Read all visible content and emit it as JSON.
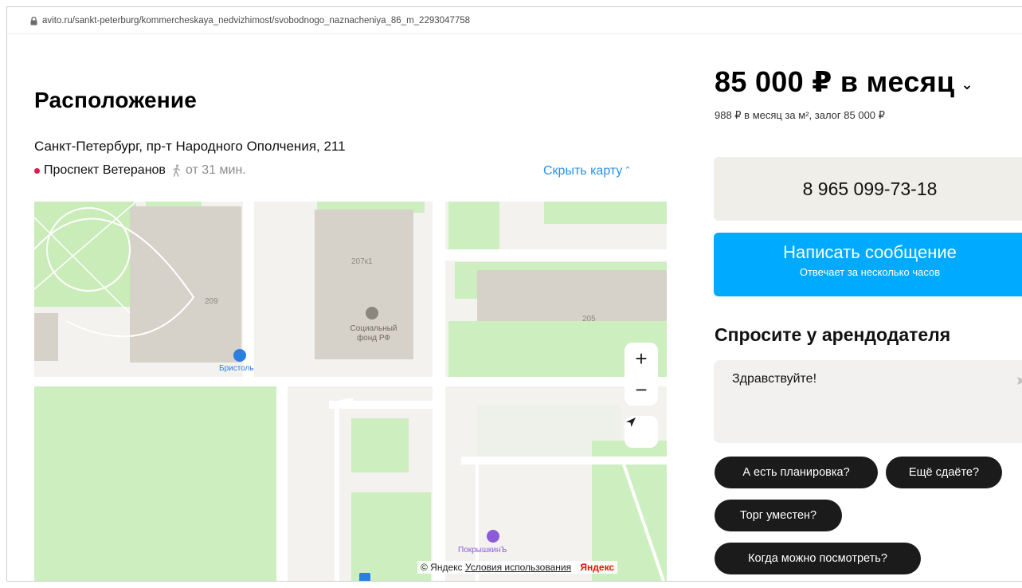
{
  "browser": {
    "url": "avito.ru/sankt-peterburg/kommercheskaya_nedvizhimost/svobodnogo_naznacheniya_86_m_2293047758"
  },
  "location": {
    "title": "Расположение",
    "address": "Санкт-Петербург, пр-т Народного Ополчения, 211",
    "metro_station": "Проспект Ветеранов",
    "metro_time": "от 31 мин.",
    "hide_map_label": "Скрыть карту",
    "metro_line_color": "#e0194b"
  },
  "map": {
    "building_labels": [
      "207к1",
      "209",
      "205"
    ],
    "poi_social_fund": "Социальный\nфонд РФ",
    "poi_bristol": "Бристоль",
    "poi_pokryshkin": "ПокрышкинЪ",
    "zoom_in_label": "+",
    "zoom_out_label": "−",
    "copyright": "© Яндекс",
    "terms_label": "Условия использования",
    "brand": "Яндекс"
  },
  "offer": {
    "price": "85 000 ₽ в месяц",
    "price_details": "988 ₽ в месяц за м², залог 85 000 ₽",
    "phone": "8 965 099-73-18",
    "message_button": "Написать сообщение",
    "message_button_sub": "Отвечает за несколько часов",
    "accent_color": "#00aaff"
  },
  "ask": {
    "title": "Спросите у арендодателя",
    "input_value": "Здравствуйте!",
    "quick_questions": [
      "А есть планировка?",
      "Ещё сдаёте?",
      "Торг уместен?",
      "Когда можно посмотреть?"
    ]
  }
}
